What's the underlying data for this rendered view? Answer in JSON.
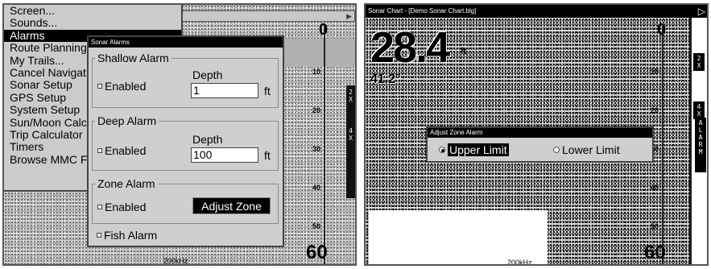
{
  "left": {
    "menu": {
      "items": [
        "Screen...",
        "Sounds...",
        "Alarms",
        "Route Planning",
        "My Trails...",
        "Cancel Navigation",
        "Sonar Setup",
        "GPS Setup",
        "System Setup",
        "Sun/Moon Calc",
        "Trip Calculator",
        "Timers",
        "Browse MMC Files"
      ],
      "selected_index": 2
    },
    "sonar_alarms": {
      "title": "Sonar Alarms",
      "shallow": {
        "title": "Shallow Alarm",
        "enabled_label": "Enabled",
        "depth_label": "Depth",
        "value": "1",
        "unit": "ft"
      },
      "deep": {
        "title": "Deep Alarm",
        "enabled_label": "Enabled",
        "depth_label": "Depth",
        "value": "100",
        "unit": "ft"
      },
      "zone": {
        "title": "Zone Alarm",
        "enabled_label": "Enabled",
        "button_label": "Adjust Zone"
      },
      "fish": {
        "label": "Fish Alarm"
      }
    },
    "scale": {
      "top": "0",
      "ticks": [
        "10",
        "20",
        "30",
        "40",
        "50"
      ],
      "bottom": "60"
    },
    "freq": "200kHz",
    "zoom_badges": [
      "2",
      "X",
      "4",
      "X"
    ]
  },
  "right": {
    "title": "Sonar Chart - [Demo Sonar Chart.blg]",
    "depth": "28.4",
    "depth_unit": "ft",
    "temp": "41.2°",
    "scale": {
      "top": "0",
      "ticks": [
        "10",
        "20",
        "30",
        "40",
        "50"
      ],
      "bottom": "60"
    },
    "freq": "200kHz",
    "zoom_2x": [
      "2",
      "X"
    ],
    "zoom_4x": [
      "4",
      "X"
    ],
    "alarm_letters": [
      "A",
      "L",
      "A",
      "R",
      "M"
    ],
    "adjust_zone_alarm": {
      "title": "Adjust Zone Alarm",
      "upper_label": "Upper Limit",
      "lower_label": "Lower Limit",
      "selected": "Upper Limit"
    }
  }
}
